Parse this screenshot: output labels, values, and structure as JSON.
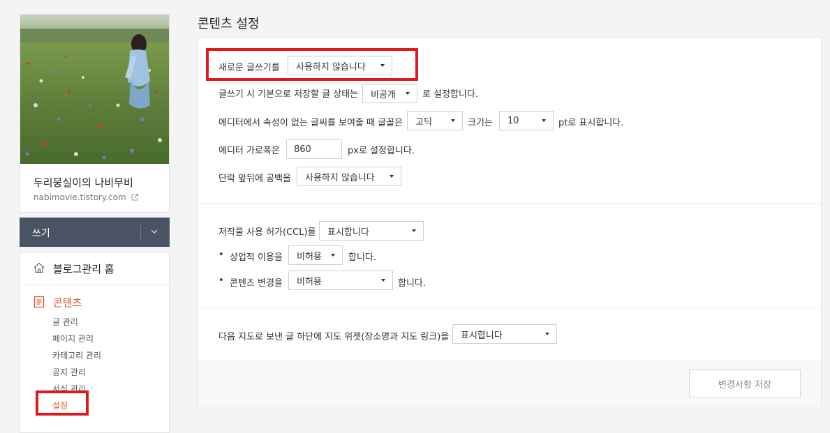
{
  "sidebar": {
    "blog_title": "두리뭉실이의 나비무비",
    "blog_url": "nabimovie.tistory.com",
    "write_label": "쓰기",
    "home_label": "블로그관리 홈",
    "content_label": "콘텐츠",
    "sub_items": [
      "글 관리",
      "페이지 관리",
      "카테고리 관리",
      "공지 관리",
      "서식 관리",
      "설정"
    ]
  },
  "main": {
    "page_title": "콘텐츠 설정",
    "new_editor": {
      "label": "새로운 글쓰기를",
      "value": "사용하지 않습니다"
    },
    "default_status": {
      "prefix": "글쓰기 시 기본으로 저장할 글 상태는",
      "value": "비공개",
      "suffix": "로 설정합니다."
    },
    "font": {
      "prefix": "에디터에서 속성이 없는 글씨를 보여줄 때 글꼴은",
      "font_value": "고딕",
      "size_label": "크기는",
      "size_value": "10",
      "suffix": "pt로 표시합니다."
    },
    "editor_width": {
      "prefix": "에디터 가로폭은",
      "value": "860",
      "suffix": "px로 설정합니다."
    },
    "paragraph_space": {
      "prefix": "단락 앞뒤에 공백을",
      "value": "사용하지 않습니다"
    },
    "ccl": {
      "prefix": "저작물 사용 허가(CCL)를",
      "value": "표시합니다"
    },
    "commercial": {
      "bullet": "•",
      "prefix": "상업적 이용을",
      "value": "비허용",
      "suffix": "합니다."
    },
    "modify": {
      "bullet": "•",
      "prefix": "콘텐츠 변경을",
      "value": "비허용",
      "suffix": "합니다."
    },
    "map_widget": {
      "prefix": "다음 지도로 보낸 글 하단에 지도 위젯(장소명과 지도 링크)을",
      "value": "표시합니다"
    },
    "save_label": "변경사항 저장"
  },
  "colors": {
    "accent": "#e0532b",
    "highlight": "#e0191f",
    "write_bar": "#4a5364"
  }
}
